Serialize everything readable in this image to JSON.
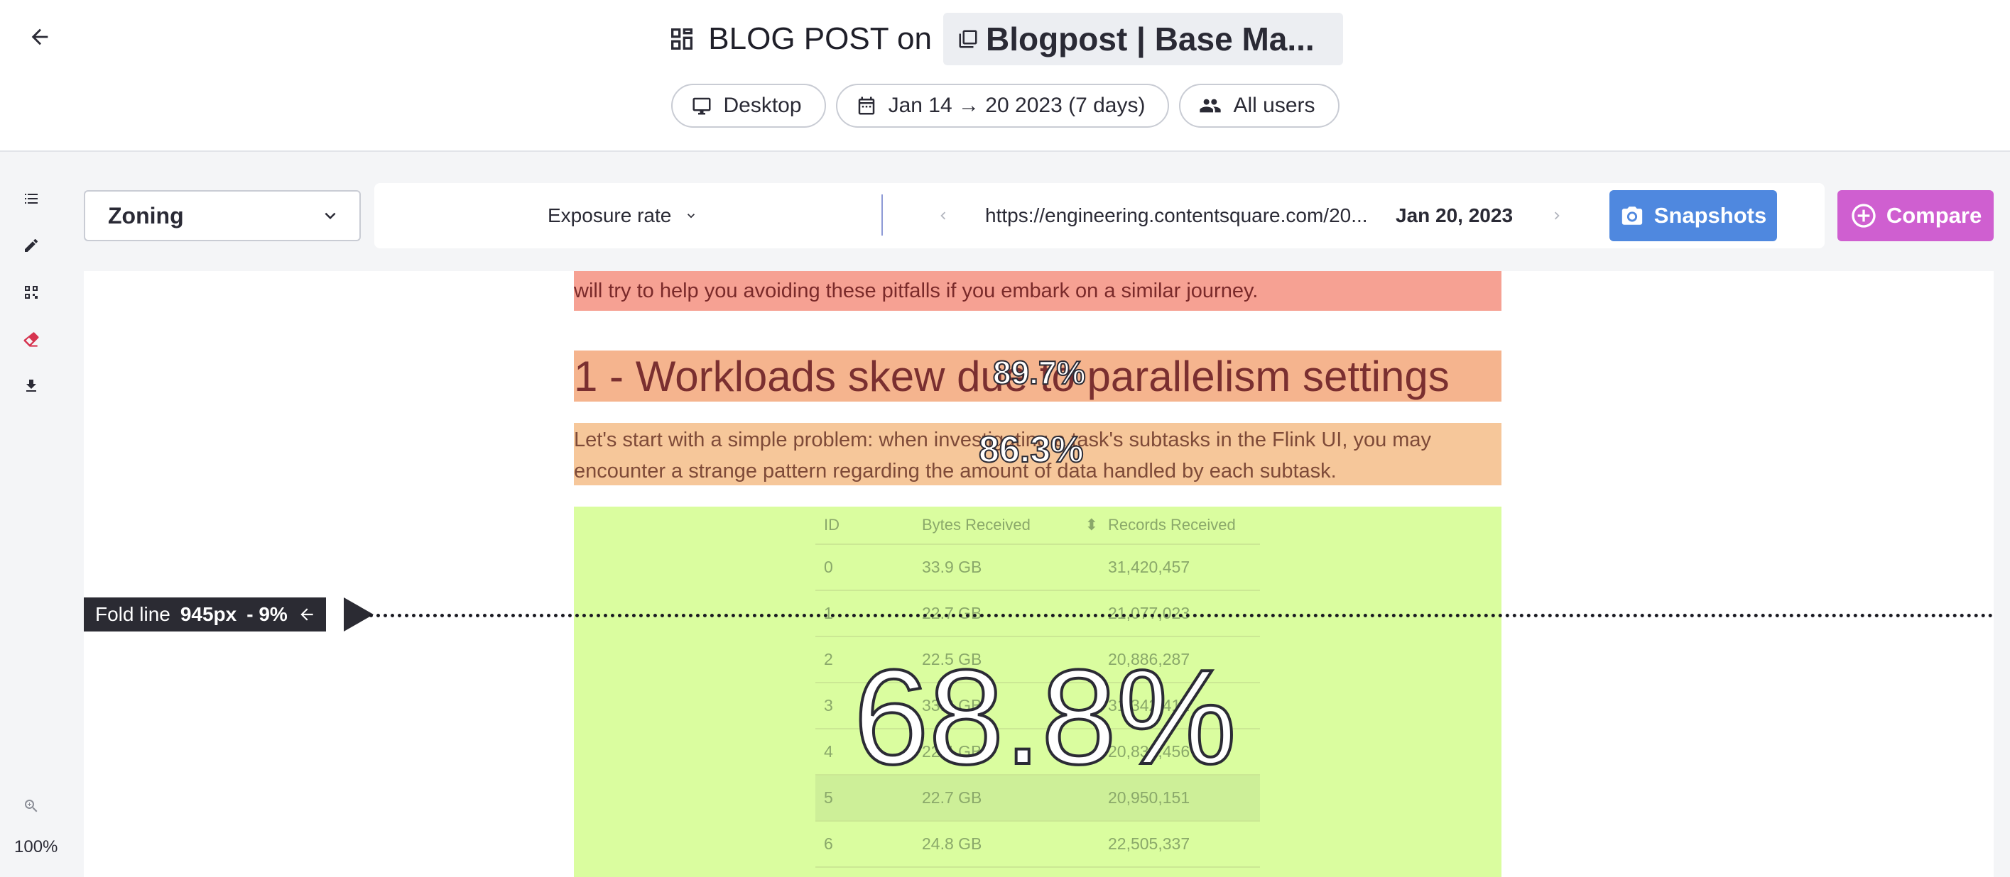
{
  "header": {
    "title_prefix": "BLOG POST on",
    "page_name": "Blogpost | Base Ma...",
    "filters": {
      "device": "Desktop",
      "date_range": "Jan 14 → 20 2023 (7 days)",
      "segment": "All users"
    }
  },
  "rail": {
    "icons": [
      "list-icon",
      "pencil-icon",
      "grid-icon",
      "eraser-icon",
      "download-icon"
    ],
    "zoom_level": "100%"
  },
  "toolbar": {
    "mode": "Zoning",
    "metric": "Exposure rate",
    "url": "https://engineering.contentsquare.com/20...",
    "snapshot_date": "Jan 20, 2023",
    "snapshots_label": "Snapshots",
    "compare_label": "Compare"
  },
  "page": {
    "top_text": "will try to help you avoiding these pitfalls if you embark on a similar journey.",
    "heading": "1 - Workloads skew due to parallelism settings",
    "paragraph": "Let's start with a simple problem: when investigating a task's subtasks in the Flink UI, you may encounter a strange pattern regarding the amount of data handled by each subtask.",
    "table": {
      "headers": [
        "ID",
        "Bytes Received",
        "Records Received"
      ],
      "rows": [
        [
          "0",
          "33.9 GB",
          "31,420,457"
        ],
        [
          "1",
          "22.7 GB",
          "21,077,023"
        ],
        [
          "2",
          "22.5 GB",
          "20,886,287"
        ],
        [
          "3",
          "33.8 GB",
          "31,342,412"
        ],
        [
          "4",
          "22.4 GB",
          "20,833,456"
        ],
        [
          "5",
          "22.7 GB",
          "20,950,151"
        ],
        [
          "6",
          "24.8 GB",
          "22,505,337"
        ]
      ]
    }
  },
  "zones": {
    "heading_rate": "89.7%",
    "paragraph_rate": "86.3%",
    "table_rate": "68.8%"
  },
  "fold_line": {
    "label": "Fold line",
    "position": "945px",
    "delta": "- 9%"
  },
  "colors": {
    "snapshots": "#4f88df",
    "compare": "#cf5fd0",
    "zone_hot": "#f6a193",
    "zone_warm": "#f5b48e",
    "zone_mild": "#f6c79a",
    "zone_cool": "#dafd9f"
  }
}
